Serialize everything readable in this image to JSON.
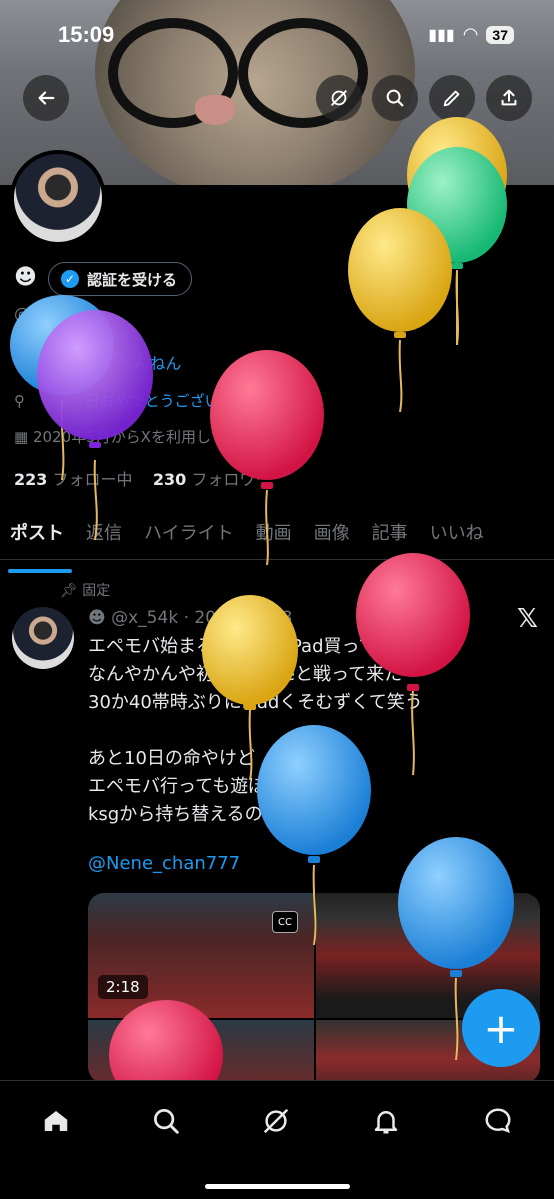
{
  "status_bar": {
    "time": "15:09",
    "battery": "37"
  },
  "header": {
    "back_icon": "back-arrow-icon",
    "grok_icon": "grok-icon",
    "search_icon": "search-icon",
    "edit_icon": "pencil-icon",
    "share_icon": "share-icon"
  },
  "profile": {
    "emoji": "☻",
    "verify_label": "認証を受ける",
    "handle": "@x_54k",
    "bio_visible": "#な",
    "bio_visible2": "んねん",
    "location_visible": "日おめでとうございます。",
    "joined": "2020年5月からXを利用しています",
    "following_count": "223",
    "following_label": "フォロー中",
    "followers_count": "230",
    "followers_label": "フォロワー"
  },
  "tabs": [
    "ポスト",
    "返信",
    "ハイライト",
    "動画",
    "画像",
    "記事",
    "いいね"
  ],
  "active_tab": 0,
  "post": {
    "pinned_label": "固定",
    "meta": "☻ @x_54k · 2024/03/08",
    "text": "エペモバ始まるらしいしiPad買って\nなんやかんや初めてneneと戦って来た\n30か40帯時ぶりにiPadくそむずくて笑う\n\nあと10日の命やけど\nエペモバ行っても遊ぼーねnene君\nksgから持ち替えるのやめろよ",
    "mention": "@Nene_chan777",
    "video_duration": "2:18",
    "cc_label": "CC"
  },
  "fab_label": "+",
  "colors": {
    "accent": "#1d9bf0",
    "background": "#000000",
    "muted": "#71767b"
  }
}
